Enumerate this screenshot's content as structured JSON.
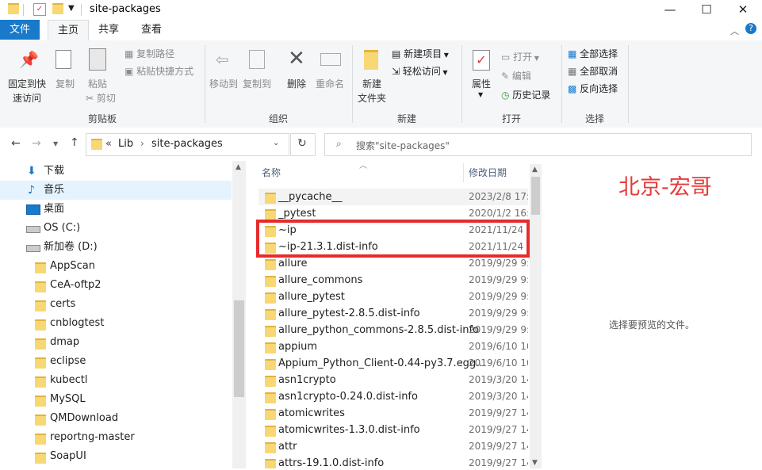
{
  "window": {
    "title": "site-packages",
    "controls": [
      "minimize-icon",
      "maximize-icon",
      "close-icon"
    ]
  },
  "ribbon_tabs": [
    {
      "label": "文件"
    },
    {
      "label": "主页"
    },
    {
      "label": "共享"
    },
    {
      "label": "查看"
    }
  ],
  "ribbon": {
    "clipboard": {
      "pin_label_1": "固定到快",
      "pin_label_2": "速访问",
      "copy": "复制",
      "paste": "粘贴",
      "copy_path": "复制路径",
      "paste_shortcut": "粘贴快捷方式",
      "cut": "剪切",
      "group": "剪贴板"
    },
    "organize": {
      "move_to": "移动到",
      "copy_to": "复制到",
      "delete": "删除",
      "rename": "重命名",
      "group": "组织"
    },
    "new": {
      "new_folder_1": "新建",
      "new_folder_2": "文件夹",
      "new_item": "新建项目",
      "easy_access": "轻松访问",
      "group": "新建"
    },
    "open": {
      "properties": "属性",
      "open": "打开",
      "edit": "编辑",
      "history": "历史记录",
      "group": "打开"
    },
    "select": {
      "select_all": "全部选择",
      "select_none": "全部取消",
      "invert": "反向选择",
      "group": "选择"
    }
  },
  "address": {
    "prefix": "«",
    "crumbs": [
      "Lib",
      "site-packages"
    ],
    "search_placeholder": "搜索\"site-packages\""
  },
  "sidebar": [
    {
      "label": "下载",
      "icon": "download-icon"
    },
    {
      "label": "音乐",
      "icon": "music-icon",
      "selected": true
    },
    {
      "label": "桌面",
      "icon": "desktop-icon"
    },
    {
      "label": "OS (C:)",
      "icon": "drive-icon"
    },
    {
      "label": "新加卷 (D:)",
      "icon": "drive-icon"
    },
    {
      "label": "AppScan",
      "icon": "folder-icon"
    },
    {
      "label": "CeA-oftp2",
      "icon": "folder-icon"
    },
    {
      "label": "certs",
      "icon": "folder-icon"
    },
    {
      "label": "cnblogtest",
      "icon": "folder-icon"
    },
    {
      "label": "dmap",
      "icon": "folder-icon"
    },
    {
      "label": "eclipse",
      "icon": "folder-icon"
    },
    {
      "label": "kubectl",
      "icon": "folder-icon"
    },
    {
      "label": "MySQL",
      "icon": "folder-icon"
    },
    {
      "label": "QMDownload",
      "icon": "folder-icon"
    },
    {
      "label": "reportng-master",
      "icon": "folder-icon"
    },
    {
      "label": "SoapUI",
      "icon": "folder-icon"
    }
  ],
  "columns": {
    "name": "名称",
    "date": "修改日期"
  },
  "files": [
    {
      "name": "__pycache__",
      "date": "2023/2/8 17:0"
    },
    {
      "name": "_pytest",
      "date": "2020/1/2 16:"
    },
    {
      "name": "~ip",
      "date": "2021/11/24 1"
    },
    {
      "name": "~ip-21.3.1.dist-info",
      "date": "2021/11/24 1"
    },
    {
      "name": "allure",
      "date": "2019/9/29 9:"
    },
    {
      "name": "allure_commons",
      "date": "2019/9/29 9:"
    },
    {
      "name": "allure_pytest",
      "date": "2019/9/29 9:"
    },
    {
      "name": "allure_pytest-2.8.5.dist-info",
      "date": "2019/9/29 9:"
    },
    {
      "name": "allure_python_commons-2.8.5.dist-info",
      "date": "2019/9/29 9:"
    },
    {
      "name": "appium",
      "date": "2019/6/10 10"
    },
    {
      "name": "Appium_Python_Client-0.44-py3.7.egg...",
      "date": "2019/6/10 10"
    },
    {
      "name": "asn1crypto",
      "date": "2019/3/20 14"
    },
    {
      "name": "asn1crypto-0.24.0.dist-info",
      "date": "2019/3/20 14"
    },
    {
      "name": "atomicwrites",
      "date": "2019/9/27 14"
    },
    {
      "name": "atomicwrites-1.3.0.dist-info",
      "date": "2019/9/27 14"
    },
    {
      "name": "attr",
      "date": "2019/9/27 14"
    },
    {
      "name": "attrs-19.1.0.dist-info",
      "date": "2019/9/27 14"
    }
  ],
  "watermark": "北京-宏哥",
  "preview_text": "选择要预览的文件。",
  "colors": {
    "accent": "#1979ca",
    "highlight": "#e52b2b",
    "folder": "#f8d775"
  }
}
